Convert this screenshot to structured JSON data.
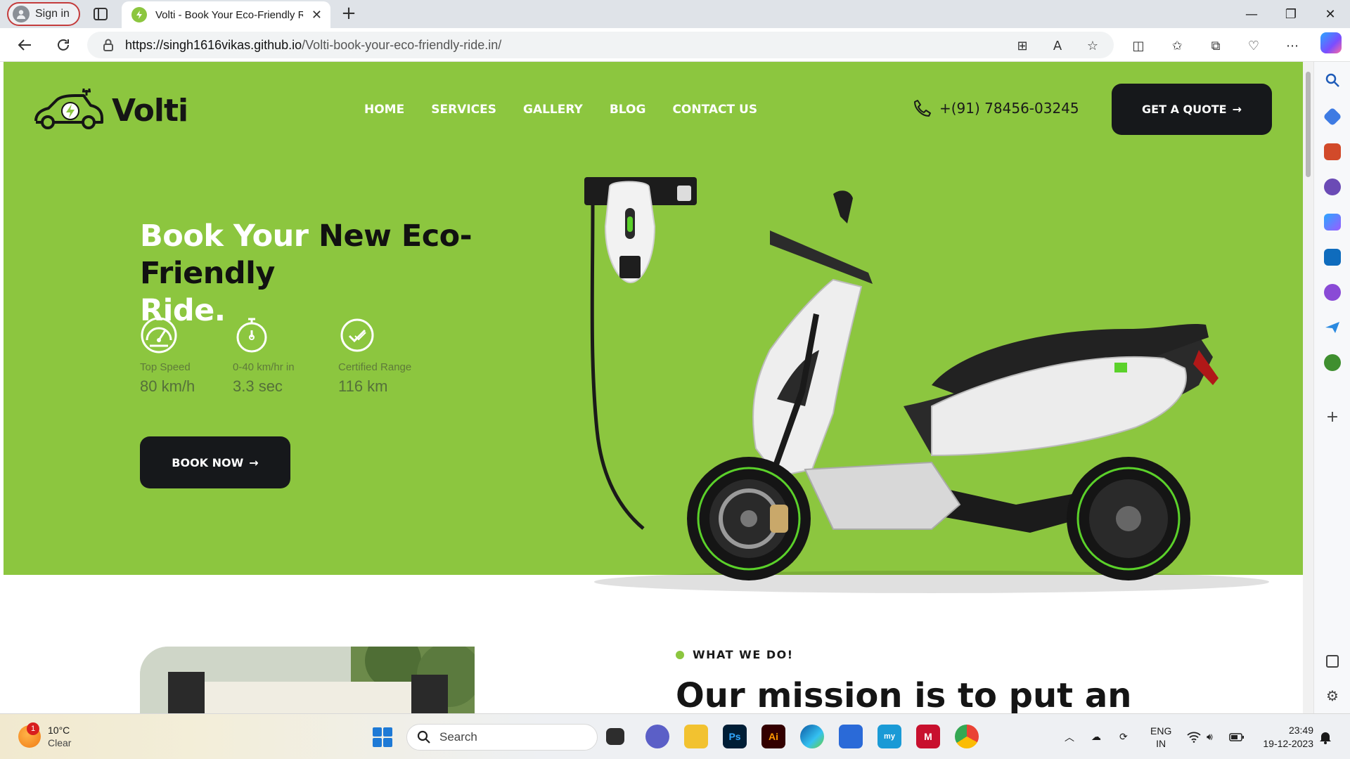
{
  "browser": {
    "signin_label": "Sign in",
    "tab_title": "Volti - Book Your Eco-Friendly Ride",
    "url_host": "https://singh1616vikas.github.io",
    "url_path": "/Volti-book-your-eco-friendly-ride.in/"
  },
  "site": {
    "logo_text": "Volti",
    "nav": [
      "HOME",
      "SERVICES",
      "GALLERY",
      "BLOG",
      "CONTACT US"
    ],
    "phone": "+(91) 78456-03245",
    "quote_button": "GET A QUOTE",
    "headline_part1": "Book Your",
    "headline_part2": "New Eco-Friendly",
    "headline_part3": "Ride.",
    "stats": [
      {
        "icon": "speedometer-icon",
        "label": "Top Speed",
        "value": "80 km/h"
      },
      {
        "icon": "stopwatch-icon",
        "label": "0-40 km/hr in",
        "value": "3.3 sec"
      },
      {
        "icon": "certified-check-icon",
        "label": "Certified Range",
        "value": "116 km"
      }
    ],
    "book_button": "BOOK NOW",
    "section_tag": "WHAT WE DO!",
    "mission_heading": "Our mission is to put an",
    "colors": {
      "brand_green": "#8cc63f",
      "dark": "#16181b"
    }
  },
  "taskbar": {
    "weather_temp": "10°C",
    "weather_desc": "Clear",
    "weather_badge": "1",
    "search_placeholder": "Search",
    "lang_top": "ENG",
    "lang_bottom": "IN",
    "time": "23:49",
    "date": "19-12-2023"
  }
}
